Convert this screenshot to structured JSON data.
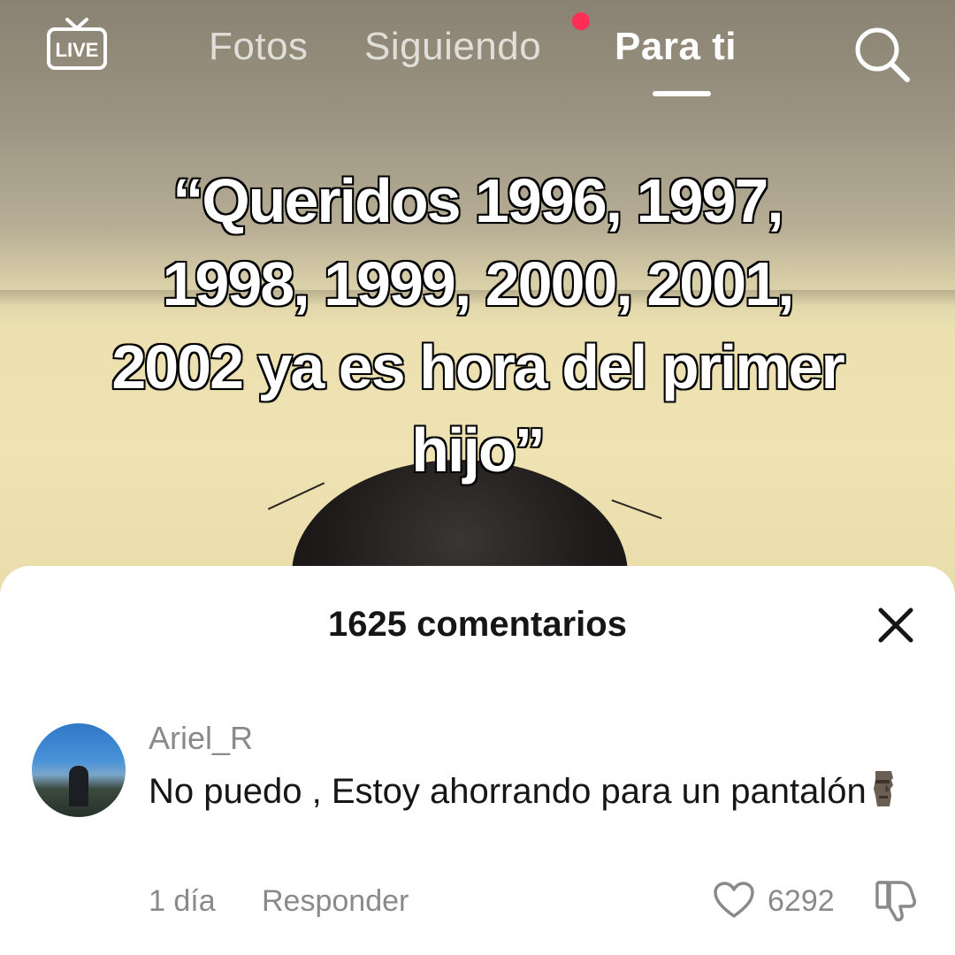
{
  "nav": {
    "live_label": "LIVE",
    "tabs": [
      {
        "label": "Fotos",
        "active": false
      },
      {
        "label": "Siguiendo",
        "active": false,
        "has_notification": true
      },
      {
        "label": "Para ti",
        "active": true
      }
    ],
    "icons": [
      "live-tv-icon",
      "search-icon"
    ]
  },
  "video": {
    "caption_lines": [
      "“Queridos 1996, 1997,",
      "1998, 1999, 2000, 2001,",
      "2002 ya es hora del primer",
      "hijo”"
    ]
  },
  "comments": {
    "count_label": "1625 comentarios",
    "close_icon": "close-icon",
    "items": [
      {
        "author": "Ariel_R",
        "text": "No puedo , Estoy ahorrando para un pantalón",
        "emoji_icon": "moai-icon",
        "time": "1 día",
        "reply_label": "Responder",
        "likes": "6292"
      }
    ]
  },
  "colors": {
    "accent_dot": "#ff2e55",
    "muted_text": "#8a8a8a",
    "primary_text": "#161616"
  }
}
